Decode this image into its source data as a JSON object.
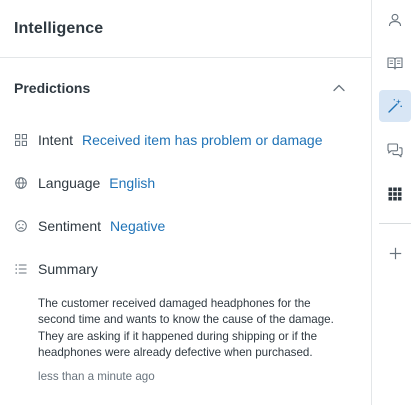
{
  "panel": {
    "title": "Intelligence"
  },
  "predictions": {
    "section_title": "Predictions",
    "intent": {
      "label": "Intent",
      "value": "Received item has problem or damage"
    },
    "language": {
      "label": "Language",
      "value": "English"
    },
    "sentiment": {
      "label": "Sentiment",
      "value": "Negative"
    },
    "summary": {
      "label": "Summary",
      "text": "The customer received damaged headphones for the second time and wants to know the cause of the damage. They are asking if it happened during shipping or if the headphones were already defective when purchased.",
      "timestamp": "less than a minute ago"
    }
  },
  "rail": {
    "items": [
      "user-icon",
      "knowledge-icon",
      "magic-wand-icon",
      "conversations-icon",
      "apps-icon",
      "add-icon"
    ],
    "active": "magic-wand-icon"
  },
  "colors": {
    "link": "#1f73b7",
    "active_bg": "#d8e6f5",
    "border": "#e3e6e8"
  }
}
